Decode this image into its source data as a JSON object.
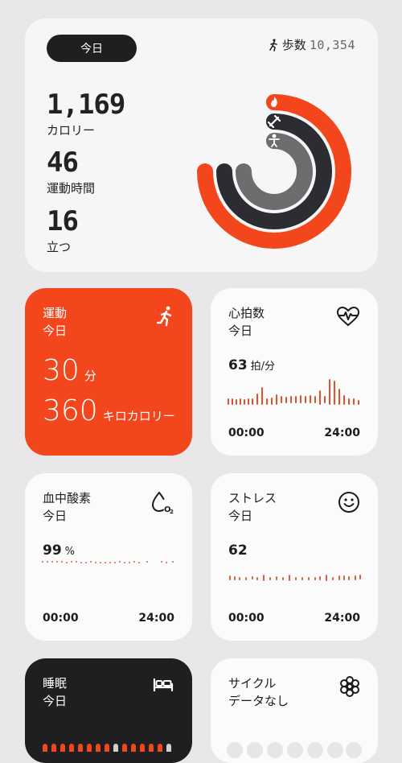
{
  "summary": {
    "today": "今日",
    "steps_label": "歩数",
    "steps_value": "10,354",
    "calories": {
      "value": "1,169",
      "label": "カロリー"
    },
    "exercise_time": {
      "value": "46",
      "label": "運動時間"
    },
    "stand": {
      "value": "16",
      "label": "立つ"
    },
    "colors": {
      "move": "#f4461d",
      "exercise": "#2c2d33",
      "stand": "#6d6d70"
    }
  },
  "exercise": {
    "title": "運動",
    "subtitle": "今日",
    "minutes": "30",
    "minutes_unit": "分",
    "calories": "360",
    "calories_unit": "キロカロリー",
    "color": "#f4461d"
  },
  "heart_rate": {
    "title": "心拍数",
    "subtitle": "今日",
    "value": "63",
    "unit": "拍/分",
    "time_start": "00:00",
    "time_end": "24:00"
  },
  "spo2": {
    "title": "血中酸素",
    "subtitle": "今日",
    "value": "99",
    "unit": "%",
    "time_start": "00:00",
    "time_end": "24:00"
  },
  "stress": {
    "title": "ストレス",
    "subtitle": "今日",
    "value": "62",
    "time_start": "00:00",
    "time_end": "24:00"
  },
  "sleep": {
    "title": "睡眠",
    "subtitle": "今日"
  },
  "cycle": {
    "title": "サイクル",
    "subtitle": "データなし"
  }
}
